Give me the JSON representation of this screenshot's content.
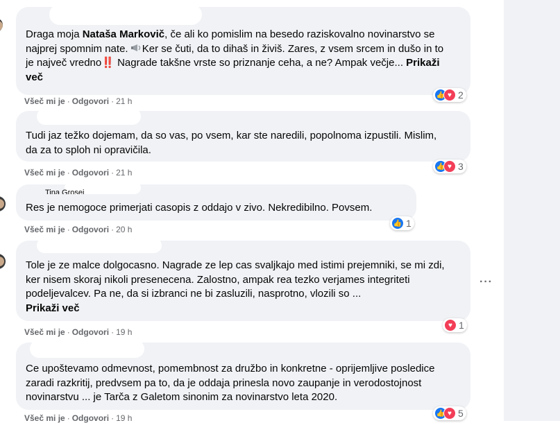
{
  "comments": [
    {
      "author": "",
      "text_parts": [
        "Draga moja ",
        "Nataša Markovič",
        ", če ali ko pomislim na besedo raziskovalno novinarstvo se najprej spomnim nate. ",
        "Ker se čuti, da to dihaš in živiš. Zares, z vsem srcem in dušo in to je največ vredno",
        "‼️",
        " Nagrade takšne vrste so priznanje ceha, a ne? Ampak večje... "
      ],
      "see_more": "Prikaži več",
      "like_label": "Všeč mi je",
      "reply_label": "Odgovori",
      "time": "21 h",
      "reaction_count": "2",
      "reactions": [
        "like",
        "love"
      ]
    },
    {
      "author": "",
      "text": "Tudi jaz težko dojemam, da so vas, po vsem, kar ste naredili, popolnoma izpustili. Mislim, da za to sploh ni opravičila.",
      "like_label": "Všeč mi je",
      "reply_label": "Odgovori",
      "time": "21 h",
      "reaction_count": "3",
      "reactions": [
        "like",
        "love"
      ]
    },
    {
      "author": "Tina Grosej",
      "text": "Res je nemogoce primerjati casopis z oddajo v zivo. Nekredibilno. Povsem.",
      "like_label": "Všeč mi je",
      "reply_label": "Odgovori",
      "time": "20 h",
      "reaction_count": "1",
      "reactions": [
        "like"
      ]
    },
    {
      "author": "",
      "text": "Tole je ze malce dolgocasno. Nagrade ze lep cas svaljkajo med istimi prejemniki, se mi zdi, ker nisem skoraj nikoli presenecena. Zalostno, ampak rea tezko verjames integriteti podeljevalcev. Pa ne, da si izbranci ne bi zasluzili, nasprotno, vlozili so ...",
      "see_more": "Prikaži več",
      "like_label": "Všeč mi je",
      "reply_label": "Odgovori",
      "time": "19 h",
      "reaction_count": "1",
      "reactions": [
        "love"
      ]
    },
    {
      "author": "",
      "text": "Ce upoštevamo odmevnost, pomembnost za družbo in konkretne - oprijemljive posledice zaradi razkritij, predvsem pa to, da je oddaja prinesla novo zaupanje in verodostojnost novinarstvu ... je Tarča z Galetom sinonim za novinarstvo leta 2020.",
      "like_label": "Všeč mi je",
      "reply_label": "Odgovori",
      "time": "19 h",
      "reaction_count": "5",
      "reactions": [
        "like",
        "love"
      ]
    }
  ],
  "colors": {
    "bubble": "#f0f2f5",
    "like": "#1877f2",
    "love": "#f33e58",
    "meta": "#65676b",
    "text": "#050505"
  },
  "icons": [
    "like-icon",
    "love-icon",
    "more-options-icon",
    "double-exclamation-icon",
    "megaphone-emoji-icon"
  ]
}
